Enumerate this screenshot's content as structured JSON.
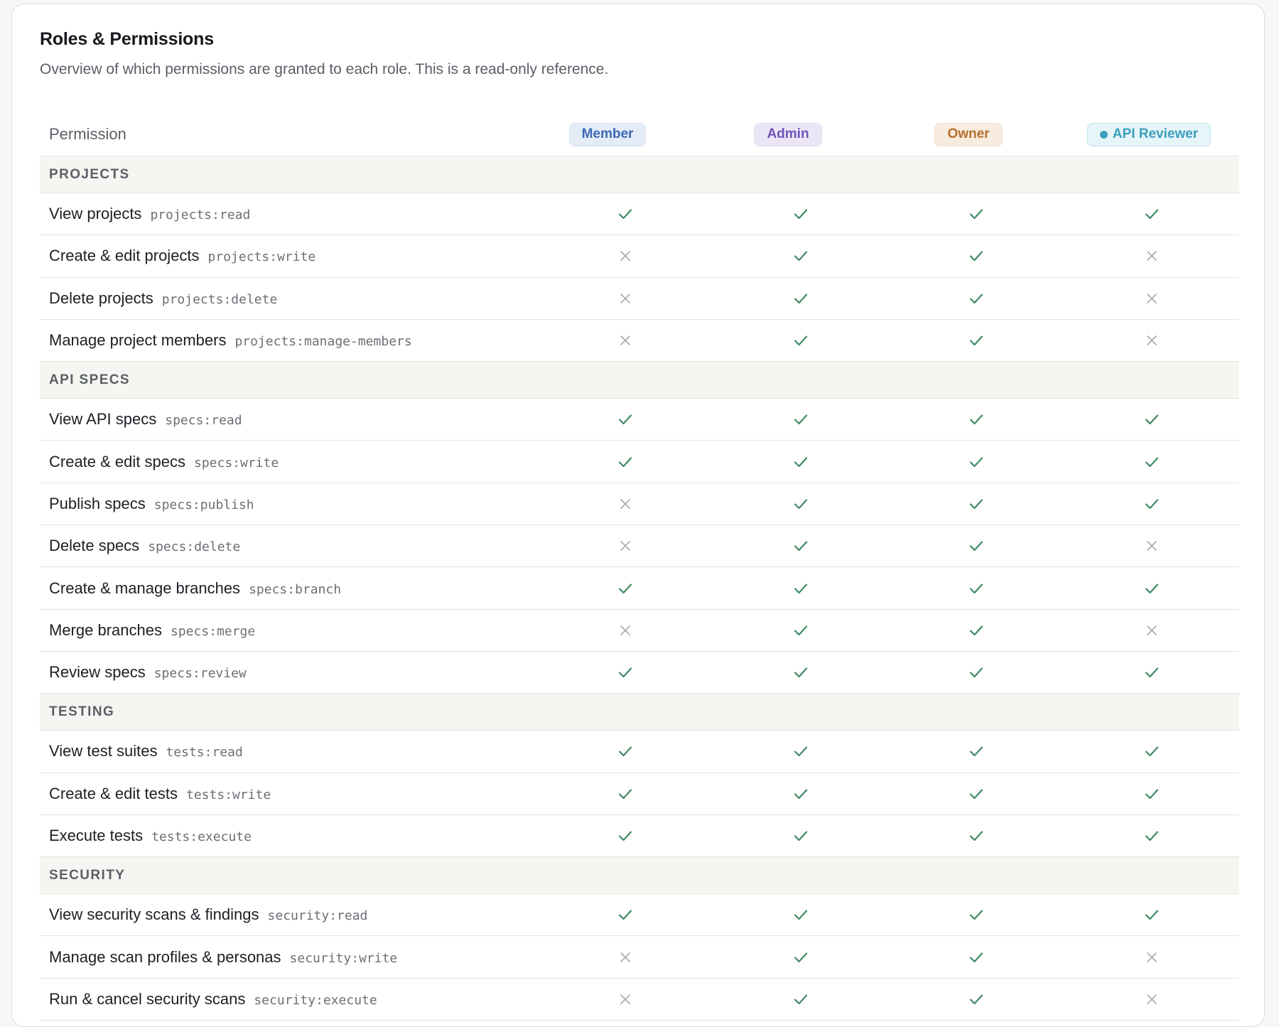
{
  "page": {
    "title": "Roles & Permissions",
    "subtitle": "Overview of which permissions are granted to each role. This is a read-only reference."
  },
  "table": {
    "permission_header": "Permission",
    "roles": [
      {
        "label": "Member",
        "bg": "#e3ecf7",
        "fg": "#3c6bb5",
        "border": "#d4e1f2",
        "dot": false
      },
      {
        "label": "Admin",
        "bg": "#ebe6f6",
        "fg": "#7152b8",
        "border": "#e0d8f1",
        "dot": false
      },
      {
        "label": "Owner",
        "bg": "#f8ebdf",
        "fg": "#b5702f",
        "border": "#f1dfcd",
        "dot": false
      },
      {
        "label": "API Reviewer",
        "bg": "#e6f5f8",
        "fg": "#3c9fbe",
        "border": "#b9e2ec",
        "dot": true
      }
    ],
    "sections": [
      {
        "name": "PROJECTS",
        "permissions": [
          {
            "name": "View projects",
            "code": "projects:read",
            "grants": [
              true,
              true,
              true,
              true
            ]
          },
          {
            "name": "Create & edit projects",
            "code": "projects:write",
            "grants": [
              false,
              true,
              true,
              false
            ]
          },
          {
            "name": "Delete projects",
            "code": "projects:delete",
            "grants": [
              false,
              true,
              true,
              false
            ]
          },
          {
            "name": "Manage project members",
            "code": "projects:manage-members",
            "grants": [
              false,
              true,
              true,
              false
            ]
          }
        ]
      },
      {
        "name": "API SPECS",
        "permissions": [
          {
            "name": "View API specs",
            "code": "specs:read",
            "grants": [
              true,
              true,
              true,
              true
            ]
          },
          {
            "name": "Create & edit specs",
            "code": "specs:write",
            "grants": [
              true,
              true,
              true,
              true
            ]
          },
          {
            "name": "Publish specs",
            "code": "specs:publish",
            "grants": [
              false,
              true,
              true,
              true
            ]
          },
          {
            "name": "Delete specs",
            "code": "specs:delete",
            "grants": [
              false,
              true,
              true,
              false
            ]
          },
          {
            "name": "Create & manage branches",
            "code": "specs:branch",
            "grants": [
              true,
              true,
              true,
              true
            ]
          },
          {
            "name": "Merge branches",
            "code": "specs:merge",
            "grants": [
              false,
              true,
              true,
              false
            ]
          },
          {
            "name": "Review specs",
            "code": "specs:review",
            "grants": [
              true,
              true,
              true,
              true
            ]
          }
        ]
      },
      {
        "name": "TESTING",
        "permissions": [
          {
            "name": "View test suites",
            "code": "tests:read",
            "grants": [
              true,
              true,
              true,
              true
            ]
          },
          {
            "name": "Create & edit tests",
            "code": "tests:write",
            "grants": [
              true,
              true,
              true,
              true
            ]
          },
          {
            "name": "Execute tests",
            "code": "tests:execute",
            "grants": [
              true,
              true,
              true,
              true
            ]
          }
        ]
      },
      {
        "name": "SECURITY",
        "permissions": [
          {
            "name": "View security scans & findings",
            "code": "security:read",
            "grants": [
              true,
              true,
              true,
              true
            ]
          },
          {
            "name": "Manage scan profiles & personas",
            "code": "security:write",
            "grants": [
              false,
              true,
              true,
              false
            ]
          },
          {
            "name": "Run & cancel security scans",
            "code": "security:execute",
            "grants": [
              false,
              true,
              true,
              false
            ]
          }
        ]
      }
    ]
  },
  "icons": {
    "granted": "check-icon",
    "denied": "x-icon"
  },
  "colors": {
    "granted": "#3f8a62",
    "denied": "#a9acb0"
  }
}
